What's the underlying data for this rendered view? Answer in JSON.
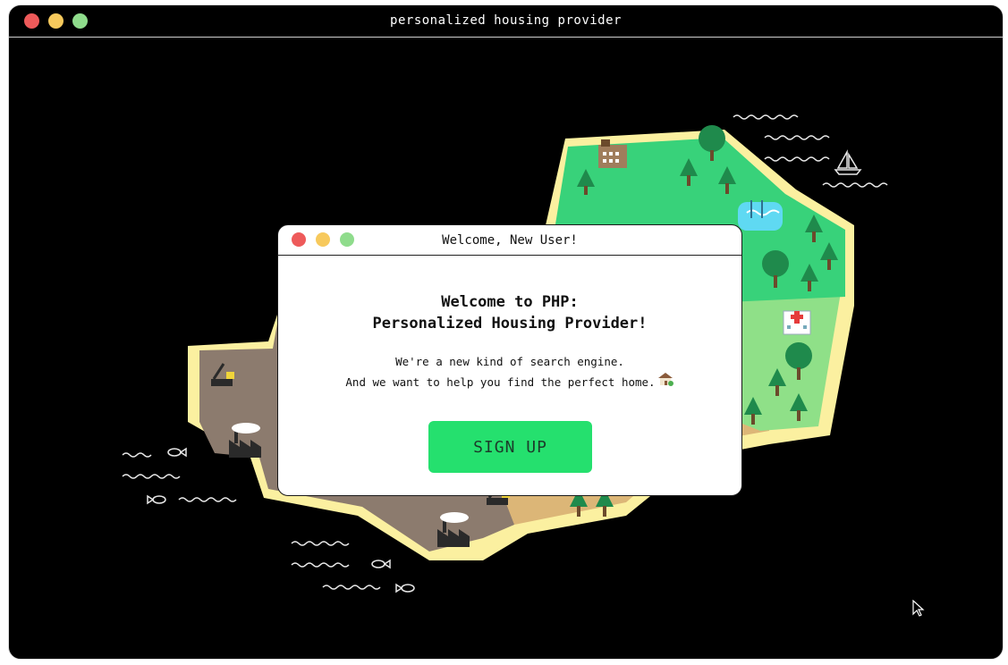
{
  "window": {
    "title": "personalized housing provider",
    "controls": {
      "close_color": "#ee5a5a",
      "minimize_color": "#f7c95c",
      "maximize_color": "#8fdc8c"
    }
  },
  "modal": {
    "title": "Welcome, New User!",
    "heading_line1": "Welcome to PHP:",
    "heading_line2": "Personalized Housing Provider!",
    "desc_line1": "We're a new kind of search engine.",
    "desc_line2": "And we want to help you find the perfect home.",
    "desc_icon": "house-with-garden-icon",
    "signup_label": "SIGN UP",
    "signup_color": "#25e06e"
  },
  "illustration": {
    "colors": {
      "shore": "#fbf0a0",
      "forest": "#38d27a",
      "meadow": "#8fe088",
      "industrial": "#8c7b6e",
      "sand": "#dcb677",
      "water": "#5fd9f2",
      "tree": "#1f8a4c"
    },
    "icons": [
      "factory-icon",
      "excavator-icon",
      "apartment-building-icon",
      "hospital-icon",
      "swimming-pool-icon",
      "sailboat-icon",
      "fish-icon",
      "tree-icon",
      "wave-icon"
    ]
  }
}
